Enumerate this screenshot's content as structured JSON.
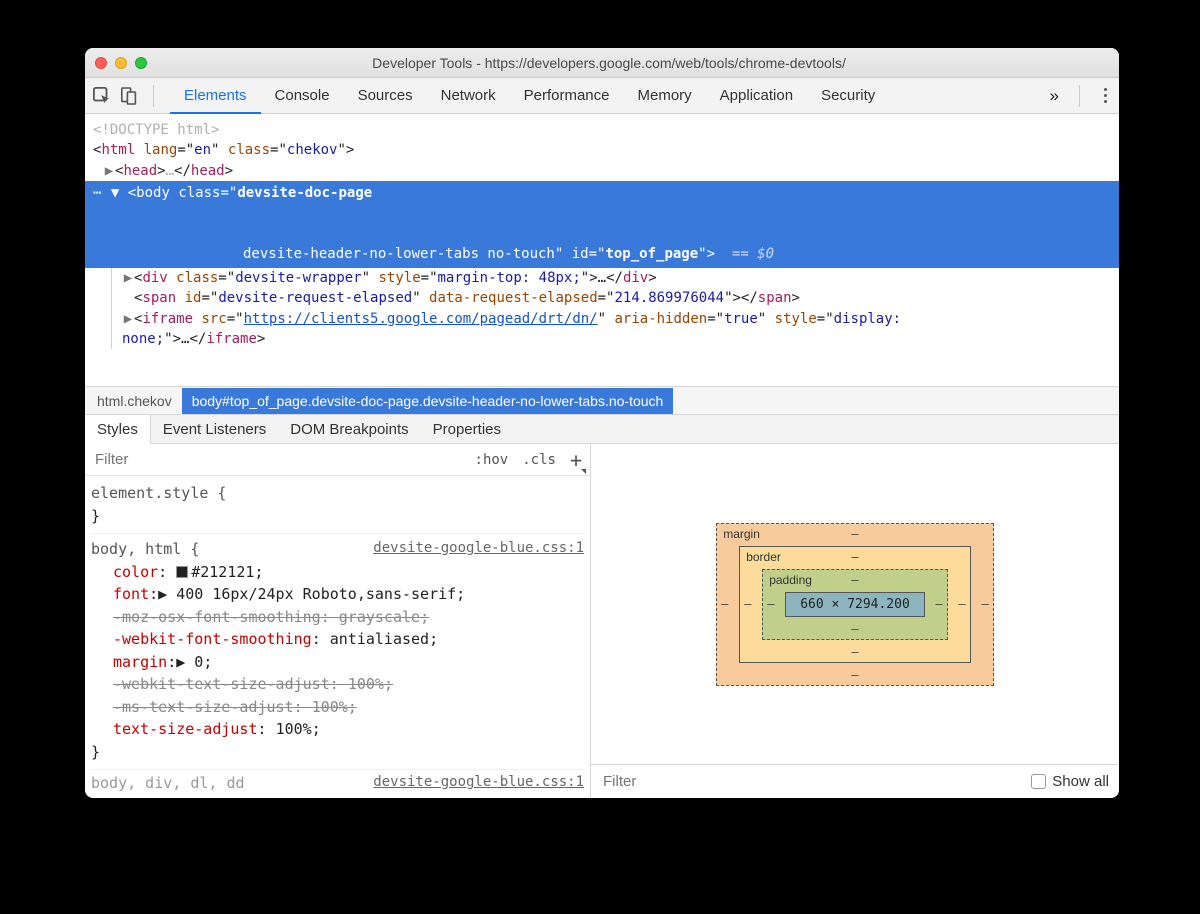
{
  "window": {
    "title": "Developer Tools - https://developers.google.com/web/tools/chrome-devtools/"
  },
  "toolbar": {
    "tabs": [
      "Elements",
      "Console",
      "Sources",
      "Network",
      "Performance",
      "Memory",
      "Application",
      "Security"
    ],
    "active": 0,
    "overflow": "»"
  },
  "dom": {
    "doctype": "<!DOCTYPE html>",
    "html_open": {
      "lang": "en",
      "class": "chekov"
    },
    "head_label": "<head>…</head>",
    "body": {
      "classes_line1": "devsite-doc-page",
      "classes_line2": "devsite-header-no-lower-tabs no-touch",
      "id": "top_of_page",
      "suffix": "== $0"
    },
    "children": {
      "div": {
        "class": "devsite-wrapper",
        "style": "margin-top: 48px;",
        "content": "…"
      },
      "span": {
        "id": "devsite-request-elapsed",
        "attr": "data-request-elapsed",
        "val": "214.869976044"
      },
      "iframe": {
        "src": "https://clients5.google.com/pagead/drt/dn/",
        "aria": "true",
        "style_pre": "display:",
        "style_post": "none;",
        "content": "…"
      }
    }
  },
  "breadcrumb": {
    "items": [
      "html.chekov",
      "body#top_of_page.devsite-doc-page.devsite-header-no-lower-tabs.no-touch"
    ],
    "selected": 1
  },
  "subtabs": {
    "items": [
      "Styles",
      "Event Listeners",
      "DOM Breakpoints",
      "Properties"
    ],
    "active": 0
  },
  "styles": {
    "filter_placeholder": "Filter",
    "hov": ":hov",
    "cls": ".cls",
    "plus": "+",
    "element_style": "element.style {",
    "close": "}",
    "rule2": {
      "selector": "body, html {",
      "source": "devsite-google-blue.css:1",
      "props": [
        {
          "n": "color",
          "v": "#212121",
          "swatch": true,
          "strike": false
        },
        {
          "n": "font",
          "v": "▶ 400 16px/24px Roboto,sans-serif",
          "strike": false
        },
        {
          "n": "-moz-osx-font-smoothing",
          "v": "grayscale",
          "strike": true
        },
        {
          "n": "-webkit-font-smoothing",
          "v": "antialiased",
          "strike": false
        },
        {
          "n": "margin",
          "v": "▶ 0",
          "strike": false
        },
        {
          "n": "-webkit-text-size-adjust",
          "v": "100%",
          "strike": true
        },
        {
          "n": "-ms-text-size-adjust",
          "v": "100%",
          "strike": true
        },
        {
          "n": "text-size-adjust",
          "v": "100%",
          "strike": false
        }
      ]
    },
    "cutoff": {
      "sel": "body, div, dl, dd",
      "src": "devsite-google-blue.css:1"
    }
  },
  "boxmodel": {
    "margin_label": "margin",
    "border_label": "border",
    "padding_label": "padding",
    "content": "660 × 7294.200",
    "dash": "–"
  },
  "computed": {
    "filter_placeholder": "Filter",
    "showall": "Show all"
  }
}
